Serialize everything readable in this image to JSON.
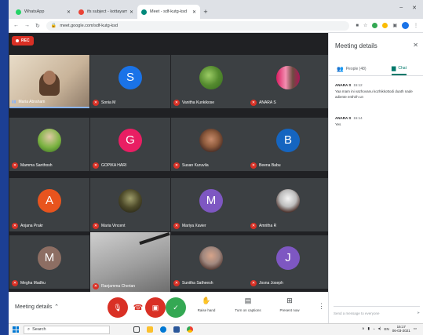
{
  "browser": {
    "tabs": [
      {
        "label": "WhatsApp",
        "favicon_color": "#25d366",
        "active": false
      },
      {
        "label": "ifs subject - kottayam@edu - Gmail",
        "favicon_color": "#ea4335",
        "active": false
      },
      {
        "label": "Meet - sdf-kutg-ksd",
        "favicon_color": "#00897b",
        "active": true
      }
    ],
    "url": "meet.google.com/sdf-kutg-ksd",
    "window_controls": [
      "–",
      "✕"
    ]
  },
  "meet": {
    "rec_label": "REC",
    "participants": [
      {
        "name": "Maria Abraham",
        "type": "video",
        "mic": "on"
      },
      {
        "name": "Sonia M",
        "type": "initial",
        "initial": "S",
        "color": "#1a73e8",
        "mic": "off"
      },
      {
        "name": "Vanitha Kunkikose",
        "type": "photo",
        "photo": "tree",
        "mic": "off"
      },
      {
        "name": "ANARA S",
        "type": "photo",
        "photo": "group",
        "mic": "off"
      },
      {
        "name": "Mamma Santhosh",
        "type": "photo",
        "photo": "outdoor",
        "mic": "off"
      },
      {
        "name": "GOPIKA HARI",
        "type": "initial",
        "initial": "G",
        "color": "#e91e63",
        "mic": "off"
      },
      {
        "name": "Susan Kuruvila",
        "type": "photo",
        "photo": "woman",
        "mic": "off"
      },
      {
        "name": "Beena Babu",
        "type": "initial",
        "initial": "B",
        "color": "#1565c0",
        "mic": "off"
      },
      {
        "name": "Anjana Prakr",
        "type": "initial",
        "initial": "A",
        "color": "#e8541e",
        "mic": "off"
      },
      {
        "name": "Maria Vincent",
        "type": "photo",
        "photo": "dark",
        "mic": "off"
      },
      {
        "name": "Mariya Xavier",
        "type": "initial",
        "initial": "M",
        "color": "#7e57c2",
        "mic": "off"
      },
      {
        "name": "Amritha R",
        "type": "photo",
        "photo": "portrait",
        "mic": "off"
      },
      {
        "name": "Megha Madhu",
        "type": "initial",
        "initial": "M",
        "color": "#8d6e63",
        "mic": "off"
      },
      {
        "name": "Ranjamma Cherian",
        "type": "video",
        "mic": "off"
      },
      {
        "name": "Sunitha Satheesh",
        "type": "photo",
        "photo": "woman2",
        "mic": "off"
      },
      {
        "name": "Josna Joseph",
        "type": "initial",
        "initial": "J",
        "color": "#7e57c2",
        "mic": "off"
      }
    ]
  },
  "controls": {
    "meeting_details_label": "Meeting details",
    "raise_hand": "Raise hand",
    "captions": "Turn on captions",
    "present": "Present now"
  },
  "panel": {
    "title": "Meeting details",
    "people_tab": "People (48)",
    "chat_tab": "Chat",
    "messages": [
      {
        "sender": "ANARA S",
        "time": "15:12",
        "text": "Yaa mam ini vazhovanu kozhikkottodi duath nade adiente enthirh un"
      },
      {
        "sender": "ANARA S",
        "time": "15:14",
        "text": "Yes"
      }
    ],
    "send_placeholder": "Send a message to everyone"
  },
  "taskbar": {
    "search_placeholder": "Search",
    "time": "15:17",
    "date": "06-03-2021"
  }
}
